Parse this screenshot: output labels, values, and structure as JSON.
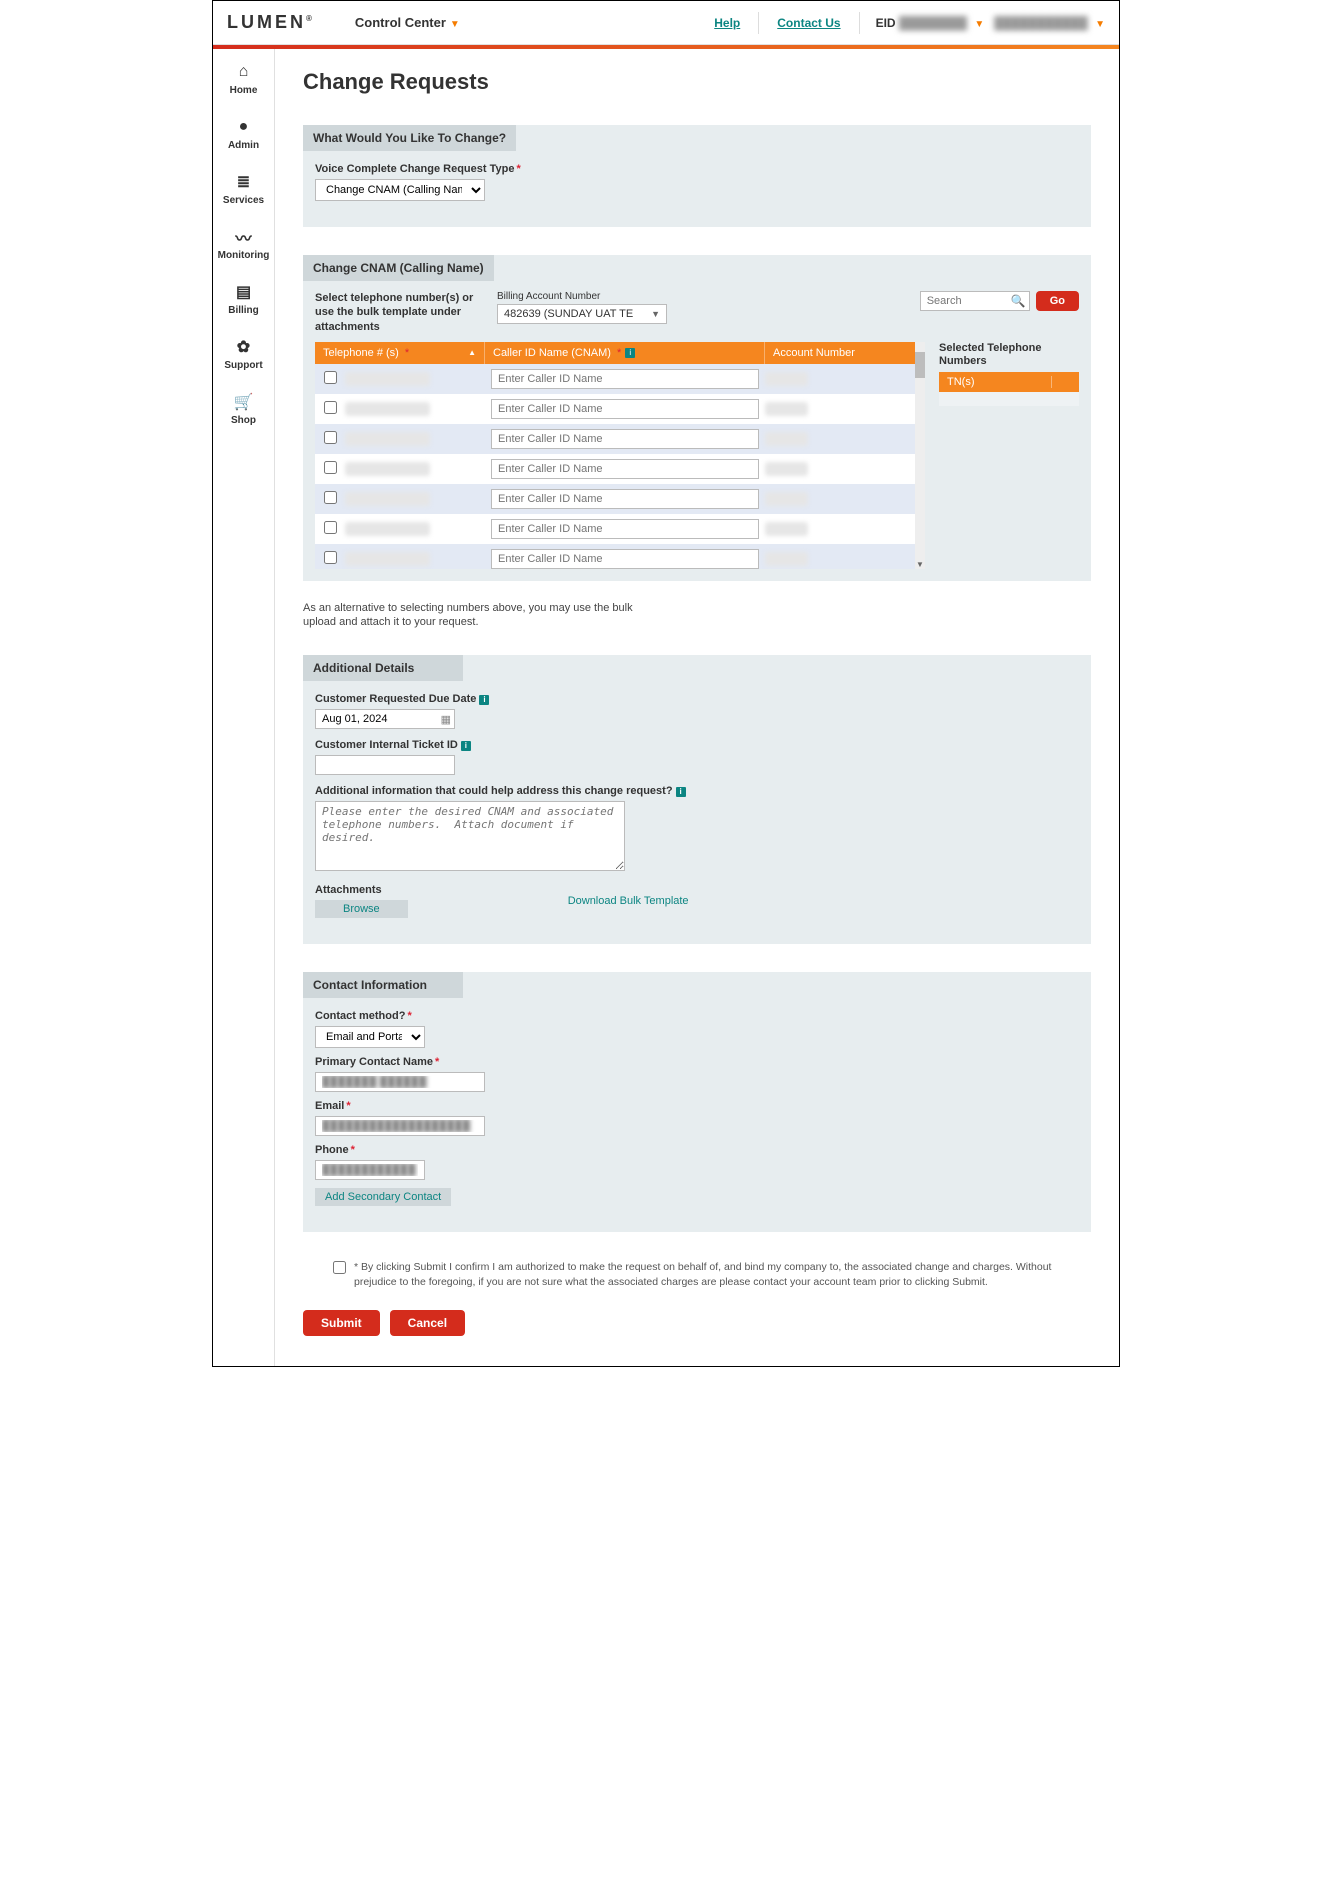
{
  "header": {
    "logo": "LUMEN",
    "logo_mark": "®",
    "product": "Control Center",
    "help": "Help",
    "contact": "Contact Us",
    "eid_label": "EID",
    "eid_value": "████████",
    "user_value": "███████████"
  },
  "sidebar": {
    "items": [
      {
        "label": "Home",
        "icon": "⌂"
      },
      {
        "label": "Admin",
        "icon": "●"
      },
      {
        "label": "Services",
        "icon": "≣"
      },
      {
        "label": "Monitoring",
        "icon": "〰"
      },
      {
        "label": "Billing",
        "icon": "▤"
      },
      {
        "label": "Support",
        "icon": "✿"
      },
      {
        "label": "Shop",
        "icon": "🛒"
      }
    ]
  },
  "page": {
    "title": "Change Requests"
  },
  "what_panel": {
    "title": "What Would You Like To Change?",
    "field_label": "Voice Complete Change Request Type",
    "select_value": "Change CNAM (Calling Nam"
  },
  "cnam_panel": {
    "title": "Change CNAM (Calling Name)",
    "instruction": "Select telephone number(s) or use the bulk template under attachments",
    "ban_label": "Billing Account Number",
    "ban_value": "482639 (SUNDAY UAT TE",
    "search_placeholder": "Search",
    "go": "Go",
    "col_tel": "Telephone # (s)",
    "col_cnam": "Caller ID Name (CNAM)",
    "col_acct": "Account Number",
    "cnam_placeholder": "Enter Caller ID Name",
    "rows": [
      {
        "tel": "██████████",
        "acct": "█████"
      },
      {
        "tel": "██████████",
        "acct": "█████"
      },
      {
        "tel": "██████████",
        "acct": "█████"
      },
      {
        "tel": "██████████",
        "acct": "█████"
      },
      {
        "tel": "██████████",
        "acct": "█████"
      },
      {
        "tel": "██████████",
        "acct": "█████"
      },
      {
        "tel": "██████████",
        "acct": "█████"
      }
    ],
    "selected_title": "Selected Telephone Numbers",
    "selected_col": "TN(s)"
  },
  "bulk_note": "As an alternative to selecting numbers above, you may use the bulk upload and attach it to your request.",
  "additional": {
    "title": "Additional Details",
    "due_label": "Customer Requested Due Date",
    "due_value": "Aug 01, 2024",
    "ticket_label": "Customer Internal Ticket ID",
    "info_label": "Additional information that could help address this change request?",
    "textarea_placeholder": "Please enter the desired CNAM and associated telephone numbers.  Attach document if desired.",
    "attachments_label": "Attachments",
    "browse": "Browse",
    "download": "Download Bulk Template"
  },
  "contact": {
    "title": "Contact Information",
    "method_label": "Contact method?",
    "method_value": "Email and Portal",
    "name_label": "Primary Contact Name",
    "name_value": "███████ ██████",
    "email_label": "Email",
    "email_value": "███████████████████",
    "phone_label": "Phone",
    "phone_value": "████████████",
    "add_secondary": "Add Secondary Contact"
  },
  "confirm": {
    "text": "* By clicking Submit I confirm I am authorized to make the request on behalf of, and bind my company to, the associated change and charges. Without prejudice to the foregoing, if you are not sure what the associated charges are please contact your account team prior to clicking Submit."
  },
  "actions": {
    "submit": "Submit",
    "cancel": "Cancel"
  }
}
